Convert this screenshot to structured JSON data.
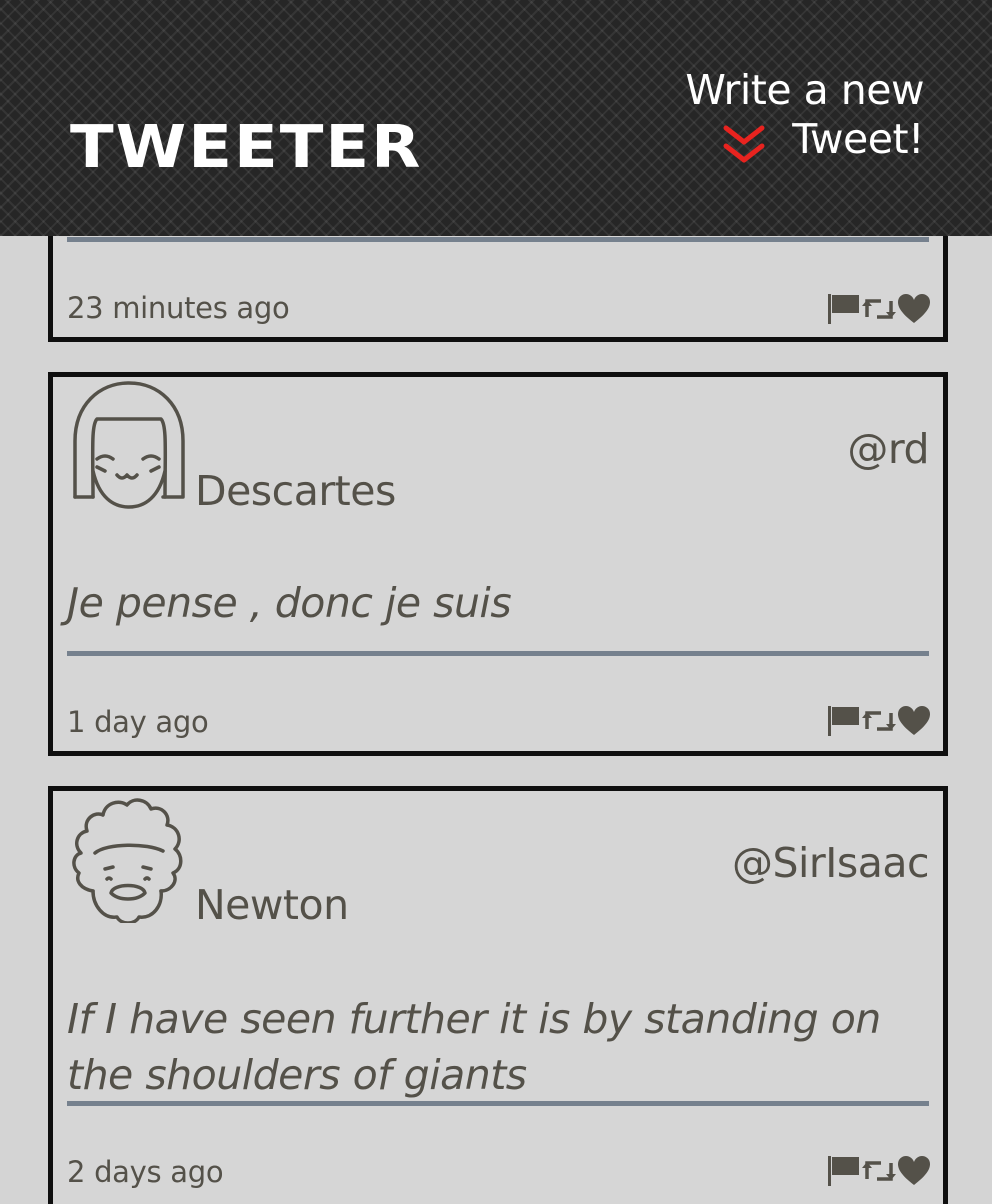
{
  "header": {
    "brand": "TWEETER",
    "compose_label": "Write a new Tweet!",
    "compose_icon": "double-chevron-down-icon",
    "accent_color": "#e8231f"
  },
  "tweets": [
    {
      "name": "",
      "handle": "",
      "text": "",
      "time": "23 minutes ago"
    },
    {
      "name": "Descartes",
      "handle": "@rd",
      "text": "Je pense , donc je suis",
      "time": "1 day ago",
      "avatar": "girl-avatar-icon"
    },
    {
      "name": "Newton",
      "handle": "@SirIsaac",
      "text": "If I have seen further it is by standing on the shoulders of giants",
      "time": "2 days ago",
      "avatar": "curly-hair-avatar-icon"
    }
  ],
  "actions": [
    "flag-icon",
    "retweet-icon",
    "heart-icon"
  ]
}
